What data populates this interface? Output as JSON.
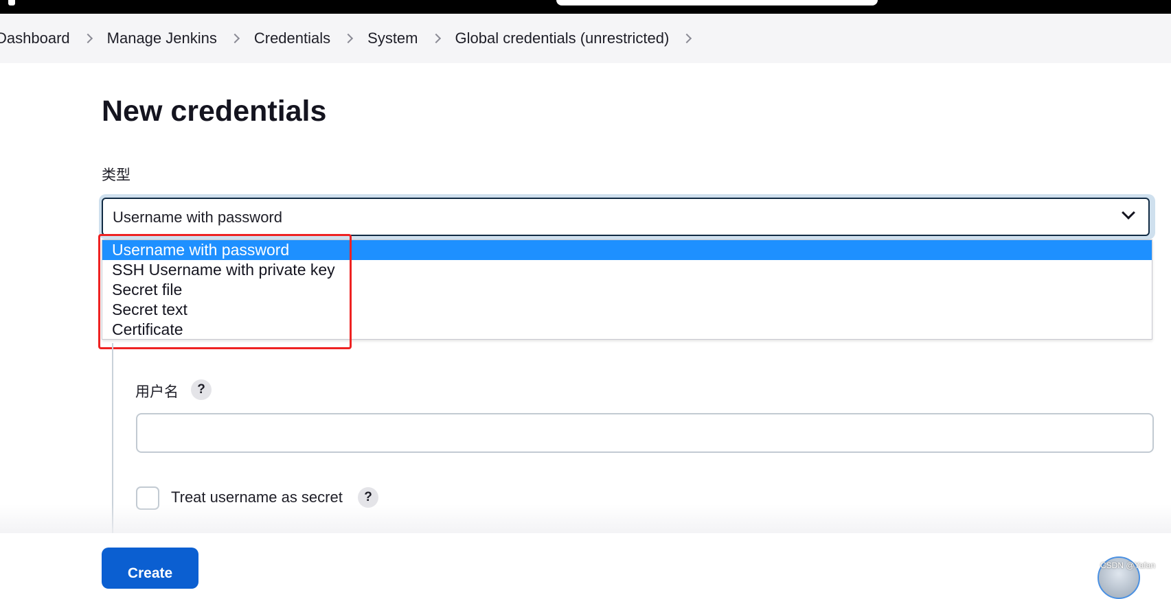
{
  "breadcrumb": {
    "items": [
      "Dashboard",
      "Manage Jenkins",
      "Credentials",
      "System",
      "Global credentials (unrestricted)"
    ]
  },
  "page": {
    "title": "New credentials"
  },
  "kind_field": {
    "label": "类型",
    "selected_value": "Username with password",
    "options": [
      "Username with password",
      "SSH Username with private key",
      "Secret file",
      "Secret text",
      "Certificate"
    ],
    "highlighted_option_index": 0
  },
  "username_field": {
    "label": "用户名",
    "value": "",
    "help_glyph": "?"
  },
  "treat_as_secret": {
    "label": "Treat username as secret",
    "checked": false,
    "help_glyph": "?"
  },
  "actions": {
    "create_label": "Create"
  },
  "watermark": {
    "text": "CSDN @Yafan"
  },
  "colors": {
    "topbar": "#000000",
    "breadcrumb_bg": "#f5f5f7",
    "option_selected_bg": "#1e90ff",
    "annotation_border": "#ee2222",
    "primary_button": "#0b5fd1"
  },
  "icons": {
    "breadcrumb_separator": "chevron-right-icon",
    "select_toggle": "chevron-down-icon",
    "help": "help-icon"
  }
}
